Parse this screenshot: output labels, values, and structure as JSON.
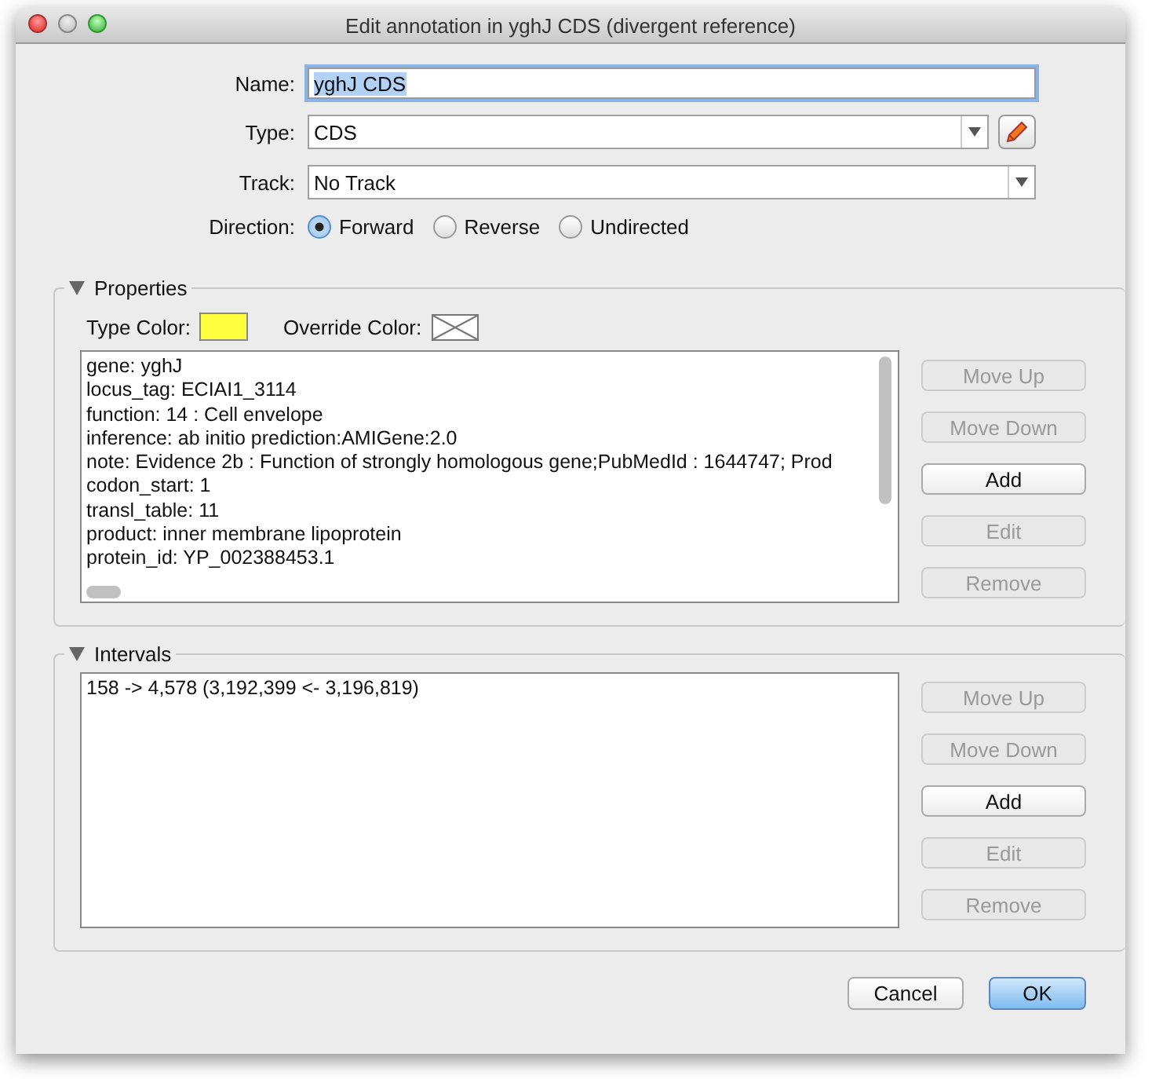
{
  "window": {
    "title": "Edit annotation in yghJ CDS (divergent reference)"
  },
  "name": {
    "label": "Name:",
    "value": "yghJ CDS",
    "selected": true
  },
  "type": {
    "label": "Type:",
    "value": "CDS"
  },
  "track": {
    "label": "Track:",
    "value": "No Track"
  },
  "direction": {
    "label": "Direction:",
    "options": [
      {
        "label": "Forward",
        "selected": true
      },
      {
        "label": "Reverse",
        "selected": false
      },
      {
        "label": "Undirected",
        "selected": false
      }
    ]
  },
  "properties": {
    "title": "Properties",
    "expanded": true,
    "type_color_label": "Type Color:",
    "override_color_label": "Override Color:",
    "items": [
      "gene: yghJ",
      "locus_tag: ECIAI1_3114",
      "function: 14 : Cell envelope",
      "inference: ab initio prediction:AMIGene:2.0",
      "note: Evidence 2b : Function of strongly homologous gene;PubMedId : 1644747; Prod",
      "codon_start: 1",
      "transl_table: 11",
      "product: inner membrane lipoprotein",
      "protein_id: YP_002388453.1"
    ],
    "buttons": [
      {
        "label": "Move Up",
        "disabled": true
      },
      {
        "label": "Move Down",
        "disabled": true
      },
      {
        "label": "Add",
        "disabled": false
      },
      {
        "label": "Edit",
        "disabled": true
      },
      {
        "label": "Remove",
        "disabled": true
      }
    ]
  },
  "intervals": {
    "title": "Intervals",
    "expanded": true,
    "items": [
      "158 -> 4,578 (3,192,399 <- 3,196,819)"
    ],
    "buttons": [
      {
        "label": "Move Up",
        "disabled": true
      },
      {
        "label": "Move Down",
        "disabled": true
      },
      {
        "label": "Add",
        "disabled": false
      },
      {
        "label": "Edit",
        "disabled": true
      },
      {
        "label": "Remove",
        "disabled": true
      }
    ]
  },
  "footer_buttons": [
    {
      "label": "Cancel",
      "default": false
    },
    {
      "label": "OK",
      "default": true
    }
  ]
}
